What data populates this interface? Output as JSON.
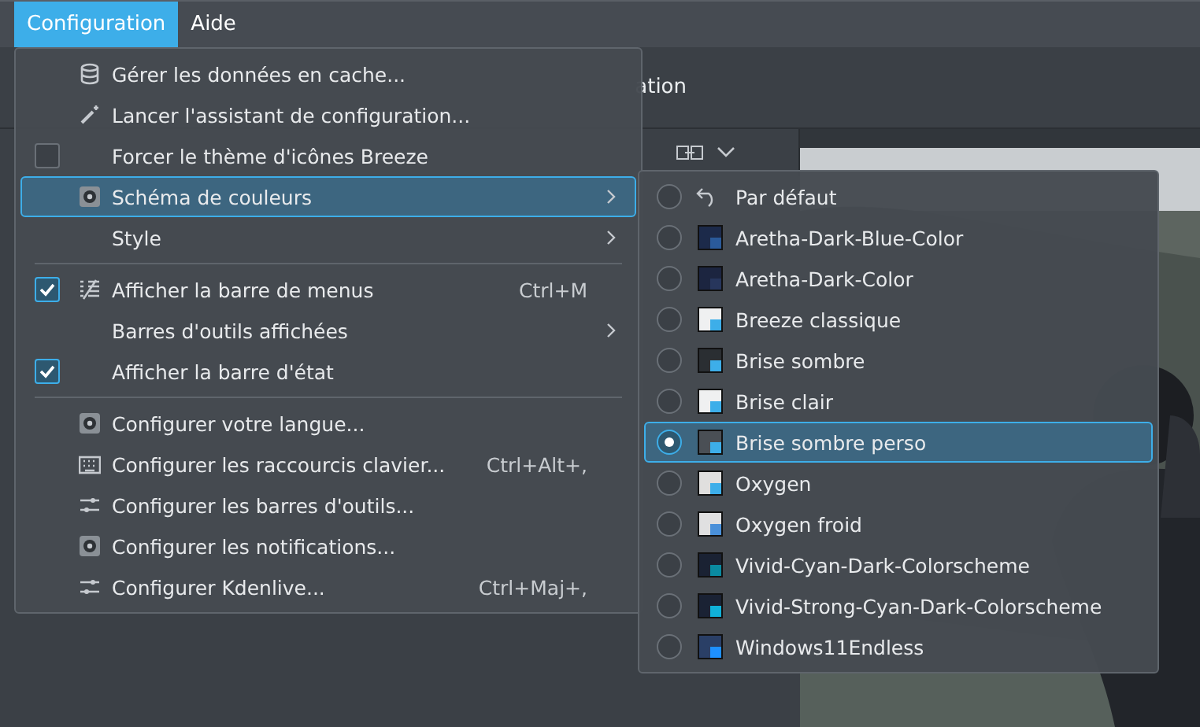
{
  "menu_bar": [
    {
      "label": "Configuration",
      "selected": true
    },
    {
      "label": "Aide",
      "selected": false
    }
  ],
  "toolbar": {
    "visible_text": "ation"
  },
  "configuration_menu": [
    {
      "kind": "item",
      "label": "Gérer les données en cache..."
    },
    {
      "kind": "item",
      "label": "Lancer l'assistant de configuration..."
    },
    {
      "kind": "check",
      "label": "Forcer le thème d'icônes Breeze",
      "checked": false
    },
    {
      "kind": "submenu",
      "label": "Schéma de couleurs",
      "selected": true
    },
    {
      "kind": "submenu",
      "label": "Style",
      "selected": false
    },
    {
      "kind": "separator"
    },
    {
      "kind": "check",
      "label": "Afficher la barre de menus",
      "shortcut": "Ctrl+M",
      "checked": true
    },
    {
      "kind": "submenu",
      "label": "Barres d'outils affichées",
      "selected": false
    },
    {
      "kind": "check",
      "label": "Afficher la barre d'état",
      "checked": true
    },
    {
      "kind": "separator"
    },
    {
      "kind": "item",
      "label": "Configurer votre langue..."
    },
    {
      "kind": "item",
      "label": "Configurer les raccourcis clavier...",
      "shortcut": "Ctrl+Alt+,"
    },
    {
      "kind": "item",
      "label": "Configurer les barres d'outils..."
    },
    {
      "kind": "item",
      "label": "Configurer les notifications..."
    },
    {
      "kind": "item",
      "label": "Configurer Kdenlive...",
      "shortcut": "Ctrl+Maj+,"
    }
  ],
  "color_scheme_menu": [
    {
      "kind": "reset",
      "label": "Par défaut",
      "selected": false
    },
    {
      "kind": "scheme",
      "label": "Aretha-Dark-Blue-Color",
      "color": "#1c2a4a",
      "selected": false
    },
    {
      "kind": "scheme",
      "label": "Aretha-Dark-Color",
      "color": "#1c2540",
      "selected": false
    },
    {
      "kind": "scheme",
      "label": "Breeze classique",
      "color": "#eff0f1",
      "selected": false
    },
    {
      "kind": "scheme",
      "label": "Brise sombre",
      "color": "#2a2e32",
      "selected": false
    },
    {
      "kind": "scheme",
      "label": "Brise clair",
      "color": "#eff0f1",
      "selected": false
    },
    {
      "kind": "scheme",
      "label": "Brise sombre perso",
      "color": "#4a4f55",
      "selected": true
    },
    {
      "kind": "scheme",
      "label": "Oxygen",
      "color": "#e0dfde",
      "selected": false
    },
    {
      "kind": "scheme",
      "label": "Oxygen froid",
      "color": "#e0e0e1",
      "selected": false
    },
    {
      "kind": "scheme",
      "label": "Vivid-Cyan-Dark-Colorscheme",
      "color": "#1a2233",
      "selected": false
    },
    {
      "kind": "scheme",
      "label": "Vivid-Strong-Cyan-Dark-Colorscheme",
      "color": "#1a2234",
      "selected": false
    },
    {
      "kind": "scheme",
      "label": "Windows11Endless",
      "color": "#2a3f66",
      "selected": false
    }
  ]
}
